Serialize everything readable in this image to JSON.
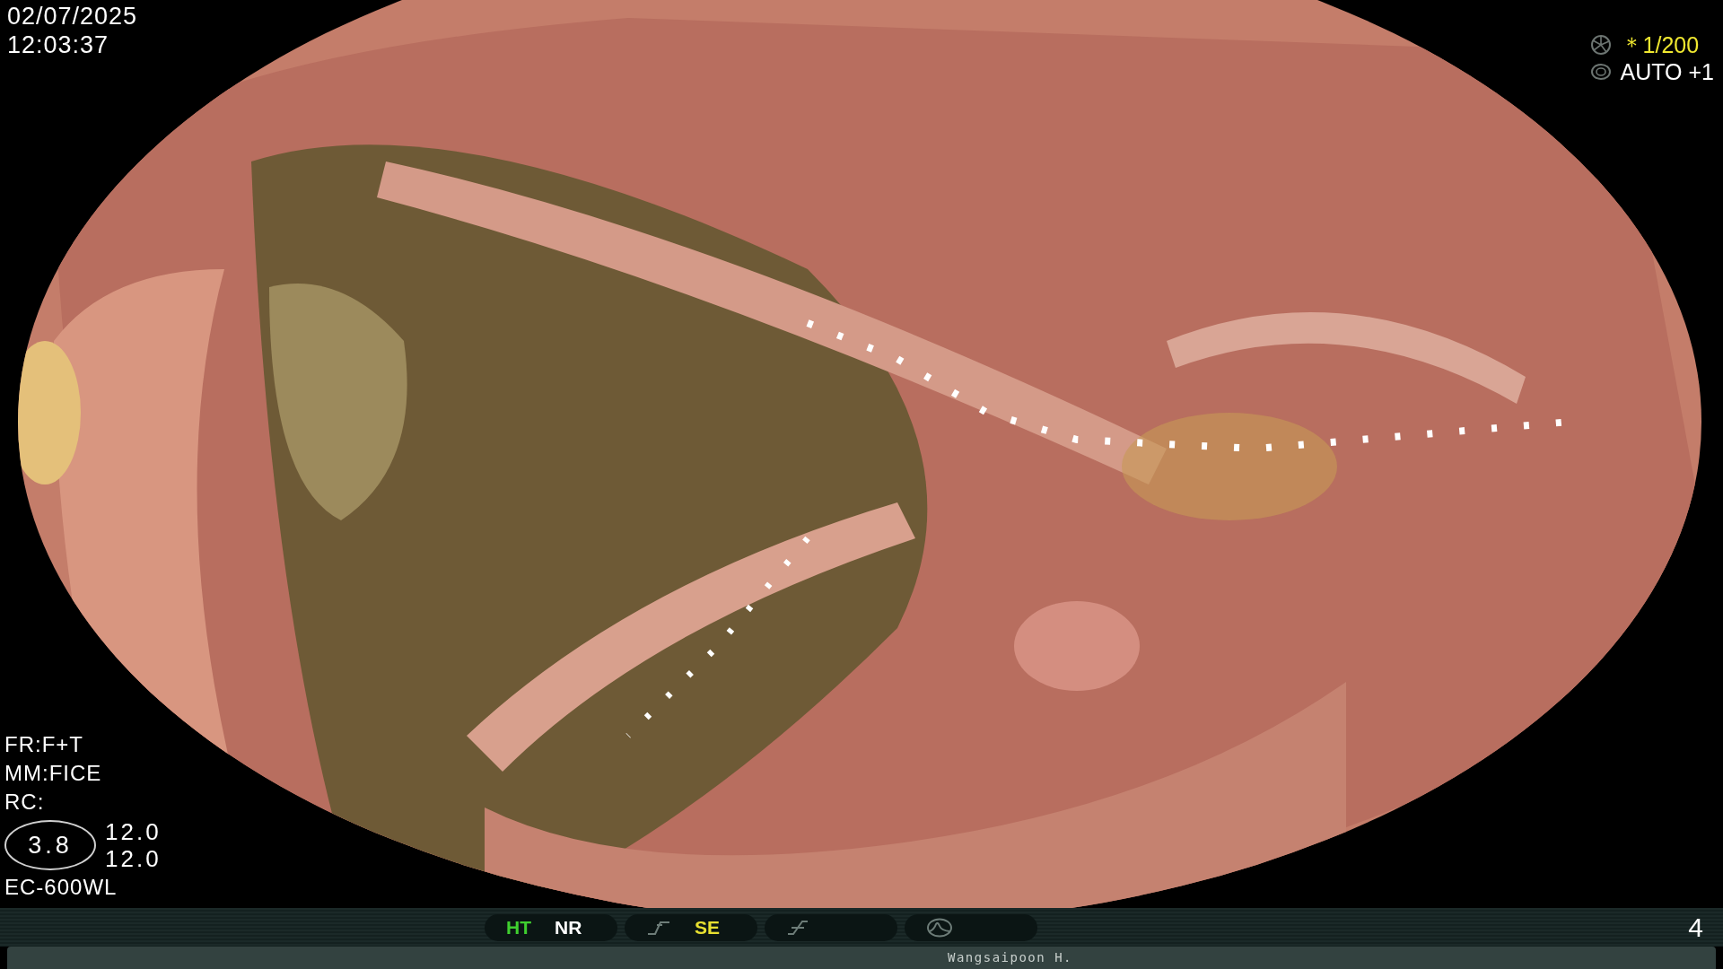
{
  "datetime": {
    "date": "02/07/2025",
    "time": "12:03:37"
  },
  "exposure": {
    "shutter": "＊1/200",
    "iris": "AUTO +1"
  },
  "settings": [
    "FR:F+T",
    "MM:FICE",
    "RC:"
  ],
  "zoom": {
    "value": "3.8",
    "readings": [
      "12.0",
      "12.0"
    ]
  },
  "scope_model": "EC-600WL",
  "indicators": [
    {
      "kind": "text",
      "labels": [
        {
          "text": "HT",
          "color": "#3fcf2f"
        },
        {
          "text": "NR",
          "color": "#ffffff"
        }
      ]
    },
    {
      "kind": "curve",
      "labels": [
        {
          "text": "SE",
          "color": "#e8e030"
        }
      ]
    },
    {
      "kind": "slash"
    },
    {
      "kind": "wave"
    }
  ],
  "image_count": "4",
  "patient_name": "Wangsaipoon H."
}
